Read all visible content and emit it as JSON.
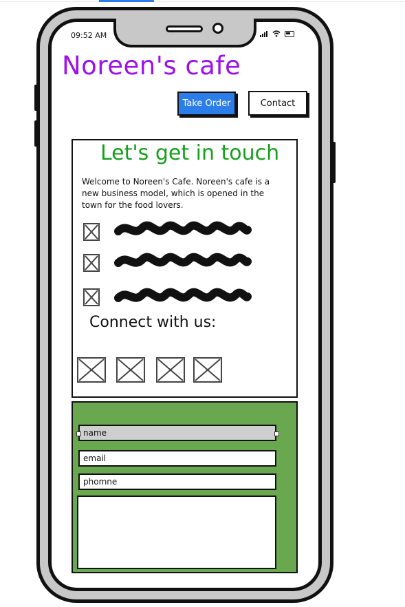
{
  "status_bar": {
    "time": "09:52 AM"
  },
  "app": {
    "title": "Noreen's cafe"
  },
  "nav": {
    "take_order": "Take Order",
    "contact": "Contact"
  },
  "contact_card": {
    "heading": "Let's get in touch",
    "description": "Welcome to Noreen's Cafe. Noreen's cafe is a new business model, which is opened in the town for the food lovers.",
    "connect_label": "Connect with us:"
  },
  "form": {
    "name_placeholder": "name",
    "email_placeholder": "email",
    "phone_placeholder": "phomne"
  },
  "colors": {
    "title": "#9d12e8",
    "heading": "#16a01c",
    "primary_button": "#2b7de9",
    "form_panel": "#6aa84f"
  },
  "icons": [
    "checkbox-placeholder-icon",
    "social-placeholder-icon",
    "wifi-icon",
    "signal-icon",
    "battery-icon"
  ]
}
